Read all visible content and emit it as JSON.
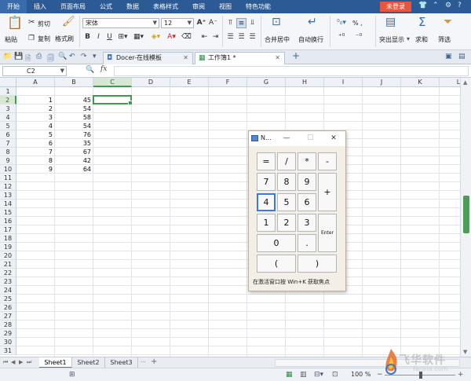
{
  "menu": {
    "tabs": [
      "开始",
      "插入",
      "页面布局",
      "公式",
      "数据",
      "表格样式",
      "审阅",
      "视图",
      "特色功能"
    ],
    "active": 0,
    "login": "未登录",
    "right_icons": [
      "skin-icon",
      "minimize-ribbon-icon",
      "help-icon"
    ]
  },
  "ribbon": {
    "paste": "粘贴",
    "cut": "剪切",
    "copy": "复制",
    "format_painter": "格式刷",
    "font_name": "宋体",
    "font_size": "12",
    "bold": "B",
    "italic": "I",
    "underline": "U",
    "merge_center": "合并居中",
    "wrap_text": "自动换行",
    "number_format": "% ,",
    "highlight": "突出显示",
    "sum": "求和",
    "filter": "筛选"
  },
  "tabbar": {
    "tabs": [
      {
        "label": "Docer-在线模板",
        "active": false
      },
      {
        "label": "工作簿1 *",
        "active": true
      }
    ],
    "add": "+"
  },
  "formulabar": {
    "name_box": "C2",
    "fx": "fx",
    "value": ""
  },
  "grid": {
    "columns": [
      "A",
      "B",
      "C",
      "D",
      "E",
      "F",
      "G",
      "H",
      "I",
      "J",
      "K",
      "L"
    ],
    "selected_column": "C",
    "selected_row": 2,
    "rows": 31,
    "values": [
      {
        "row": 2,
        "a": "1",
        "b": "45"
      },
      {
        "row": 3,
        "a": "2",
        "b": "54"
      },
      {
        "row": 4,
        "a": "3",
        "b": "58"
      },
      {
        "row": 5,
        "a": "4",
        "b": "54"
      },
      {
        "row": 6,
        "a": "5",
        "b": "76"
      },
      {
        "row": 7,
        "a": "6",
        "b": "35"
      },
      {
        "row": 8,
        "a": "7",
        "b": "67"
      },
      {
        "row": 9,
        "a": "8",
        "b": "42"
      },
      {
        "row": 10,
        "a": "9",
        "b": "64"
      }
    ]
  },
  "sheets": {
    "tabs": [
      "Sheet1",
      "Sheet2",
      "Sheet3"
    ],
    "active": 0,
    "more": "···",
    "add": "+"
  },
  "statusbar": {
    "zoom": "100 %"
  },
  "calculator": {
    "title": "N...",
    "minimize": "—",
    "maximize": "☐",
    "close": "✕",
    "keys": [
      {
        "label": "=",
        "name": "key-equals"
      },
      {
        "label": "/",
        "name": "key-divide"
      },
      {
        "label": "*",
        "name": "key-multiply"
      },
      {
        "label": "-",
        "name": "key-minus"
      },
      {
        "label": "7",
        "name": "key-7"
      },
      {
        "label": "8",
        "name": "key-8"
      },
      {
        "label": "9",
        "name": "key-9"
      },
      {
        "label": "+",
        "name": "key-plus"
      },
      {
        "label": "4",
        "name": "key-4"
      },
      {
        "label": "5",
        "name": "key-5"
      },
      {
        "label": "6",
        "name": "key-6"
      },
      {
        "label": "1",
        "name": "key-1"
      },
      {
        "label": "2",
        "name": "key-2"
      },
      {
        "label": "3",
        "name": "key-3"
      },
      {
        "label": "Enter",
        "name": "key-enter"
      },
      {
        "label": "0",
        "name": "key-0"
      },
      {
        "label": ".",
        "name": "key-decimal"
      },
      {
        "label": "(",
        "name": "key-open-paren"
      },
      {
        "label": ")",
        "name": "key-close-paren"
      }
    ],
    "focused_key": "4",
    "hint": "在激活窗口按 Win+K 获取焦点"
  },
  "watermark": {
    "text": "飞华软件",
    "site": "fanxia.com"
  },
  "colors": {
    "menubar": "#2b5a95",
    "selection": "#3e9a4c",
    "login": "#e8553f"
  }
}
